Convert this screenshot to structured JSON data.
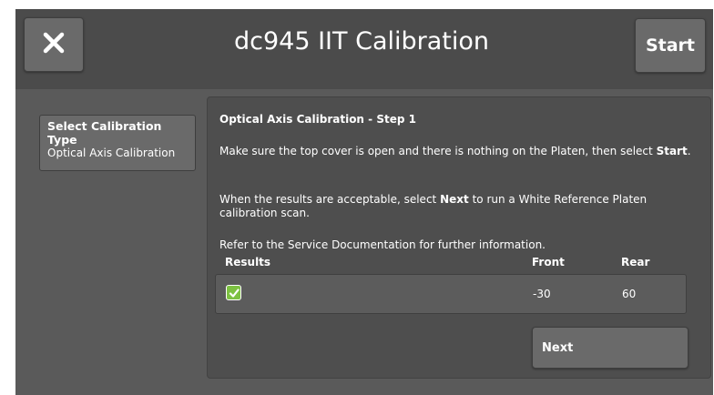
{
  "header": {
    "title": "dc945 IIT Calibration",
    "start_label": "Start",
    "close_icon": "close-icon"
  },
  "sidebar": {
    "item_label": "Select Calibration Type",
    "item_value": "Optical Axis Calibration"
  },
  "panel": {
    "step_title": "Optical Axis Calibration - Step 1",
    "para1_pre": "Make sure the top cover is open and there is nothing on the Platen, then select",
    "para1_bold": "Start",
    "para1_post": ".",
    "para2_pre": "When the results are acceptable, select",
    "para2_bold": "Next",
    "para2_post": "to run a White Reference Platen calibration scan.",
    "para3": "Refer to the Service Documentation for further information.",
    "results": {
      "columns": [
        "Results",
        "Front",
        "Rear"
      ],
      "row": {
        "checked": true,
        "front": "-30",
        "rear": "60"
      }
    },
    "next_label": "Next"
  },
  "colors": {
    "background": "#5a5a5a",
    "header": "#4b4b4b",
    "button": "#6a6a6a",
    "check_green": "#7dc142"
  }
}
